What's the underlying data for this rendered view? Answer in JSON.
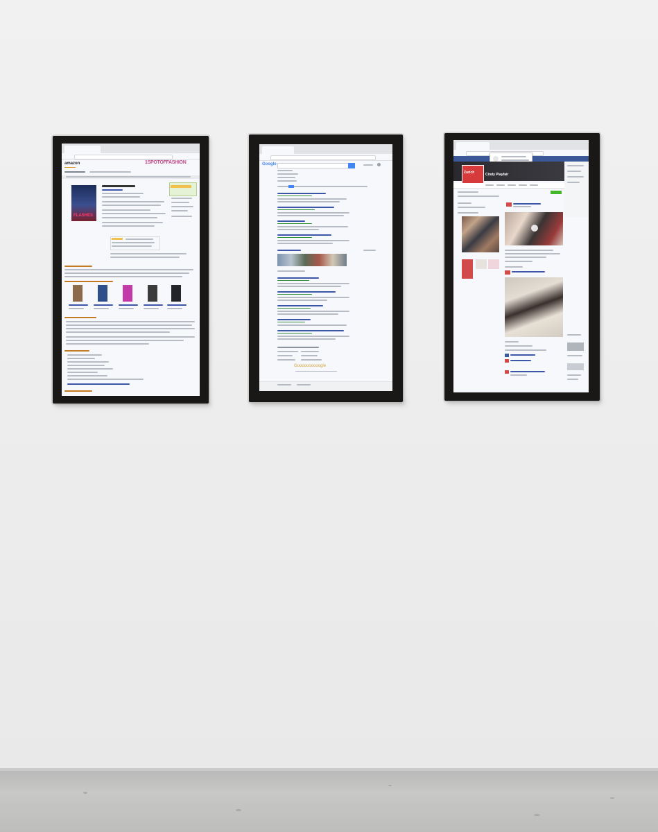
{
  "screens": {
    "left": {
      "site_logo": "amazon",
      "ad_banner": "1SPOTOFFASHION",
      "poster_title": "FLASHES"
    },
    "middle": {
      "site_logo": "Google",
      "footer_logo": "Goooooooooogle"
    },
    "right": {
      "profile_name": "Cindy Playfair",
      "cover_word": "Zurich"
    }
  },
  "colors": {
    "wall": "#eeeeee",
    "floor": "#c2c2c0",
    "bezel": "#1a1717",
    "screen": "#f7f8fb",
    "amazon_orange": "#e69a2e",
    "google_blue": "#4285f4",
    "facebook_blue": "#3b5998"
  }
}
